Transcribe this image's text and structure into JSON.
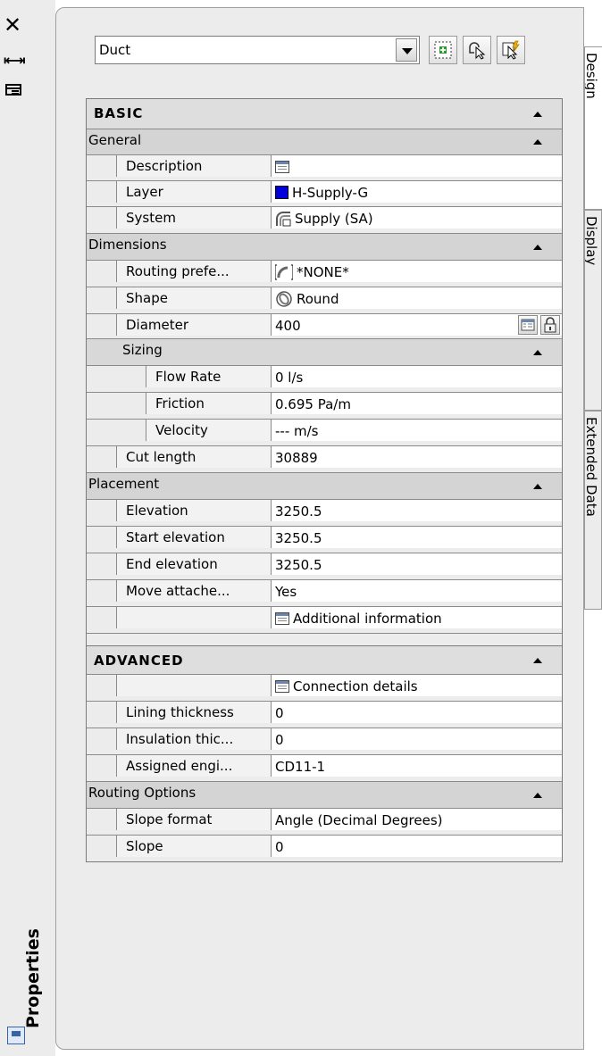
{
  "strip": {
    "title": "Properties"
  },
  "toolbar": {
    "style_value": "Duct"
  },
  "tabs": [
    "Design",
    "Display",
    "Extended Data"
  ],
  "grid": {
    "basic": {
      "label": "BASIC",
      "general": {
        "label": "General",
        "rows": [
          {
            "name": "Description",
            "value": "",
            "icon": "table-icon"
          },
          {
            "name": "Layer",
            "value": "H-Supply-G",
            "icon": "layer-color-icon",
            "color": "#0000dd"
          },
          {
            "name": "System",
            "value": "Supply (SA)",
            "icon": "system-icon"
          }
        ]
      },
      "dimensions": {
        "label": "Dimensions",
        "rows": [
          {
            "name": "Routing prefe...",
            "value": "*NONE*",
            "icon": "routing-icon"
          },
          {
            "name": "Shape",
            "value": "Round",
            "icon": "round-shape-icon"
          },
          {
            "name": "Diameter",
            "value": "400"
          }
        ],
        "sizing": {
          "label": "Sizing",
          "rows": [
            {
              "name": "Flow Rate",
              "value": "0 l/s"
            },
            {
              "name": "Friction",
              "value": "0.695 Pa/m"
            },
            {
              "name": "Velocity",
              "value": "--- m/s"
            }
          ]
        },
        "cut_length": {
          "name": "Cut length",
          "value": "30889"
        }
      },
      "placement": {
        "label": "Placement",
        "rows": [
          {
            "name": "Elevation",
            "value": "3250.5"
          },
          {
            "name": "Start elevation",
            "value": "3250.5"
          },
          {
            "name": "End elevation",
            "value": "3250.5"
          },
          {
            "name": "Move attache...",
            "value": "Yes"
          },
          {
            "name": "",
            "value": "Additional information",
            "icon": "table-icon"
          }
        ]
      }
    },
    "advanced": {
      "label": "ADVANCED",
      "rows": [
        {
          "name": "",
          "value": "Connection details",
          "icon": "table-icon"
        },
        {
          "name": "Lining thickness",
          "value": "0"
        },
        {
          "name": "Insulation thic...",
          "value": "0"
        },
        {
          "name": "Assigned engi...",
          "value": "CD11-1"
        }
      ],
      "routing_options": {
        "label": "Routing Options",
        "rows": [
          {
            "name": "Slope format",
            "value": "Angle (Decimal Degrees)"
          },
          {
            "name": "Slope",
            "value": "0"
          }
        ]
      }
    }
  }
}
